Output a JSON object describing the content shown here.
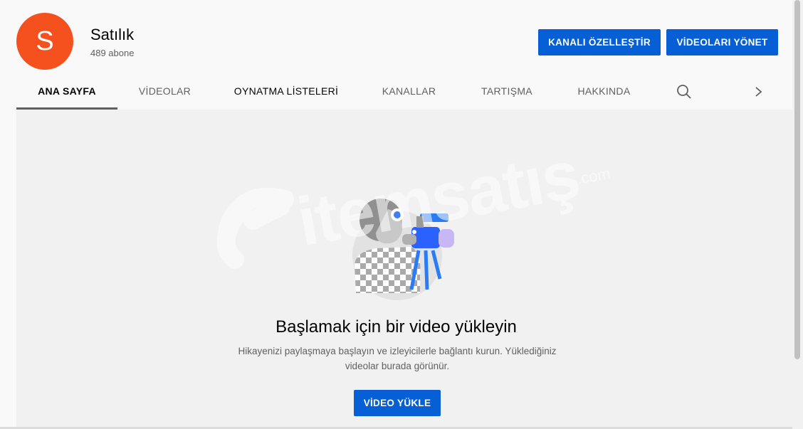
{
  "channel": {
    "avatar_letter": "S",
    "name": "Satılık",
    "subscribers": "489 abone"
  },
  "actions": {
    "customize_label": "KANALI ÖZELLEŞTİR",
    "manage_label": "VİDEOLARI YÖNET"
  },
  "tabs": [
    {
      "label": "ANA SAYFA",
      "active": true
    },
    {
      "label": "VİDEOLAR"
    },
    {
      "label": "OYNATMA LİSTELERİ"
    },
    {
      "label": "KANALLAR"
    },
    {
      "label": "TARTIŞMA"
    },
    {
      "label": "HAKKINDA"
    }
  ],
  "icons": {
    "search": "search-icon",
    "next": "chevron-right-icon"
  },
  "empty_state": {
    "title": "Başlamak için bir video yükleyin",
    "description": "Hikayenizi paylaşmaya başlayın ve izleyicilerle bağlantı kurun. Yüklediğiniz videolar burada görünür.",
    "upload_label": "VİDEO YÜKLE"
  },
  "watermark": {
    "text": "itemsatış",
    "subtext": ".com"
  },
  "colors": {
    "brand_blue": "#065fd4",
    "avatar": "#f4511e"
  }
}
